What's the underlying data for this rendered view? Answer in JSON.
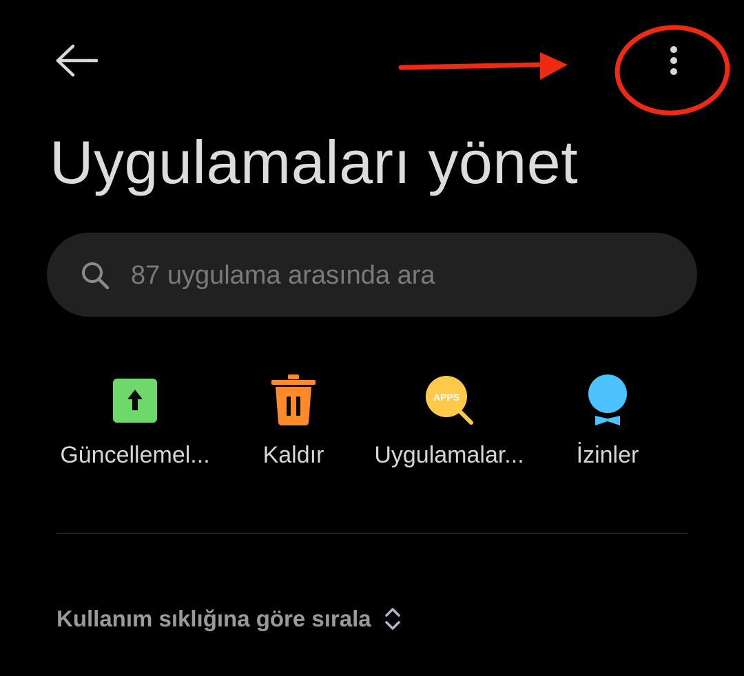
{
  "header": {
    "back_icon": "arrow-left-icon",
    "more_icon": "more-vertical-icon"
  },
  "title": "Uygulamaları yönet",
  "search": {
    "icon": "search-icon",
    "value": "",
    "placeholder": "87 uygulama arasında ara"
  },
  "quick_actions": [
    {
      "label": "Güncellemel...",
      "icon": "update-icon",
      "color": "#6fd86a"
    },
    {
      "label": "Kaldır",
      "icon": "trash-icon",
      "color": "#ff8a2a"
    },
    {
      "label": "Uygulamalar...",
      "icon": "apps-search-icon",
      "color": "#ffc94a",
      "icon_text": "APPS"
    },
    {
      "label": "İzinler",
      "icon": "permissions-icon",
      "color": "#4cc3ff"
    }
  ],
  "sort": {
    "label": "Kullanım sıklığına göre sırala",
    "icon": "sort-toggle-icon"
  },
  "colors": {
    "background": "#000000",
    "search_bg": "#212121",
    "annotation": "#ee2a12"
  }
}
